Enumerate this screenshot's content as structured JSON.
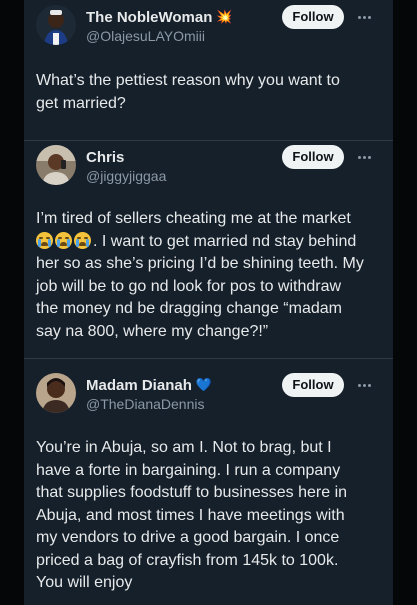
{
  "posts": [
    {
      "name": "The NobleWoman",
      "badge_icon": "collision-emoji",
      "handle": "@OlajesuLAYOmiii",
      "follow_label": "Follow",
      "text_lines": [
        "What’s the pettiest reason why you want to",
        "get married?"
      ]
    },
    {
      "name": "Chris",
      "handle": "@jiggyjiggaa",
      "follow_label": "Follow",
      "text_lines": [
        "I’m tired of sellers cheating me at the market",
        ". I want to get married nd stay behind",
        "her so as she’s pricing I’d be shining teeth. My",
        "job will be to go nd look for pos to withdraw",
        "the money nd be dragging change “madam",
        "say na 800, where my change?!”"
      ],
      "emojis": [
        "loudly-crying-face",
        "loudly-crying-face",
        "loudly-crying-face"
      ]
    },
    {
      "name": "Madam Dianah",
      "badge_icon": "blue-heart-emoji",
      "handle": "@TheDianaDennis",
      "follow_label": "Follow",
      "text_lines": [
        "You’re in Abuja, so am I. Not to brag, but I",
        "have a forte in bargaining. I run a company",
        "that supplies foodstuff to businesses here in",
        "Abuja, and most times I have meetings with",
        "my vendors to drive a good bargain. I once",
        "priced a bag of crayfish from 145k to 100k.",
        "You will enjoy"
      ]
    }
  ],
  "colors": {
    "background": "#15202b",
    "text": "#e7e9ea",
    "secondary_text": "#8b98a5",
    "follow_button": "#eff3f4"
  }
}
